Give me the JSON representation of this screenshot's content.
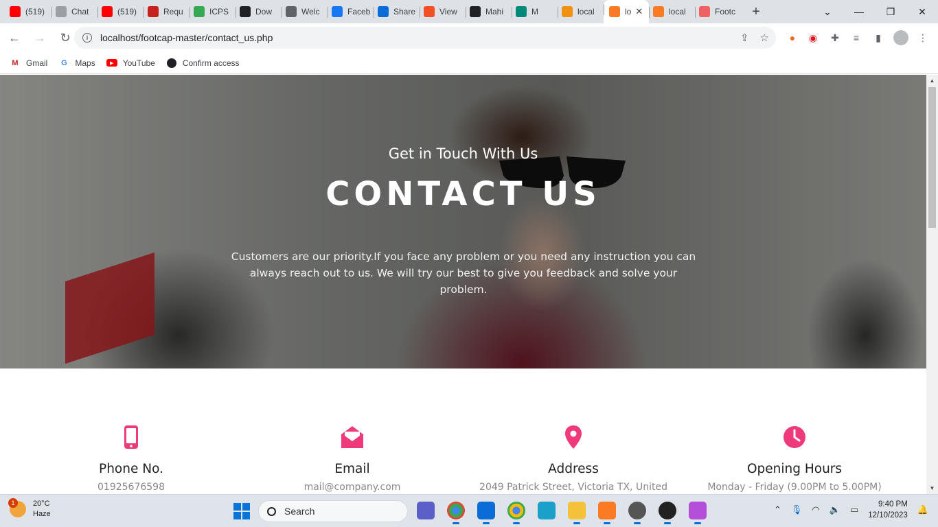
{
  "browser": {
    "tabs": [
      {
        "label": "(519)",
        "icon": "youtube-icon",
        "color": "#ff0000"
      },
      {
        "label": "Chat",
        "icon": "chatgpt-icon",
        "color": "#9aa0a6"
      },
      {
        "label": "(519)",
        "icon": "youtube-icon",
        "color": "#ff0000"
      },
      {
        "label": "Requ",
        "icon": "gmail-icon",
        "color": "#c5221f"
      },
      {
        "label": "ICPS",
        "icon": "globe-icon",
        "color": "#34a853"
      },
      {
        "label": "Dow",
        "icon": "openai-icon",
        "color": "#202124"
      },
      {
        "label": "Welc",
        "icon": "globe-icon",
        "color": "#5f6368"
      },
      {
        "label": "Faceb",
        "icon": "facebook-icon",
        "color": "#1877f2"
      },
      {
        "label": "Share",
        "icon": "onedrive-icon",
        "color": "#0a6cd6"
      },
      {
        "label": "View",
        "icon": "microsoft-icon",
        "color": "#f25022"
      },
      {
        "label": "Mahi",
        "icon": "github-icon",
        "color": "#202124"
      },
      {
        "label": "M",
        "icon": "meet-icon",
        "color": "#00897b"
      },
      {
        "label": "local",
        "icon": "phpmyadmin-icon",
        "color": "#f29111"
      },
      {
        "label": "lo",
        "icon": "xampp-icon",
        "color": "#fb7a24",
        "active": true
      },
      {
        "label": "local",
        "icon": "xampp-icon",
        "color": "#fb7a24"
      },
      {
        "label": "Footc",
        "icon": "footcap-icon",
        "color": "#f06262"
      }
    ],
    "new_tab": "+",
    "url": "localhost/footcap-master/contact_us.php",
    "bookmarks": [
      {
        "label": "Gmail",
        "icon": "gmail-icon"
      },
      {
        "label": "Maps",
        "icon": "google-icon"
      },
      {
        "label": "YouTube",
        "icon": "youtube-icon"
      },
      {
        "label": "Confirm access",
        "icon": "github-icon"
      }
    ]
  },
  "hero": {
    "subtitle": "Get in Touch With Us",
    "title": "CONTACT US",
    "text": "Customers are our priority.If you face any problem or you need any instruction you can always reach out to us. We will try our best to give you feedback and solve your problem."
  },
  "contact_cards": [
    {
      "icon": "phone-icon",
      "title": "Phone No.",
      "value": "01925676598"
    },
    {
      "icon": "envelope-icon",
      "title": "Email",
      "value": "mail@company.com"
    },
    {
      "icon": "location-pin-icon",
      "title": "Address",
      "value": "2049 Patrick Street, Victoria TX, United"
    },
    {
      "icon": "clock-icon",
      "title": "Opening Hours",
      "value": "Monday - Friday (9.00PM to 5.00PM)"
    }
  ],
  "accent_color": "#ee3a7a",
  "taskbar": {
    "weather_badge": "1",
    "temperature": "20°C",
    "condition": "Haze",
    "search_placeholder": "Search",
    "time": "9:40 PM",
    "date": "12/10/2023"
  }
}
